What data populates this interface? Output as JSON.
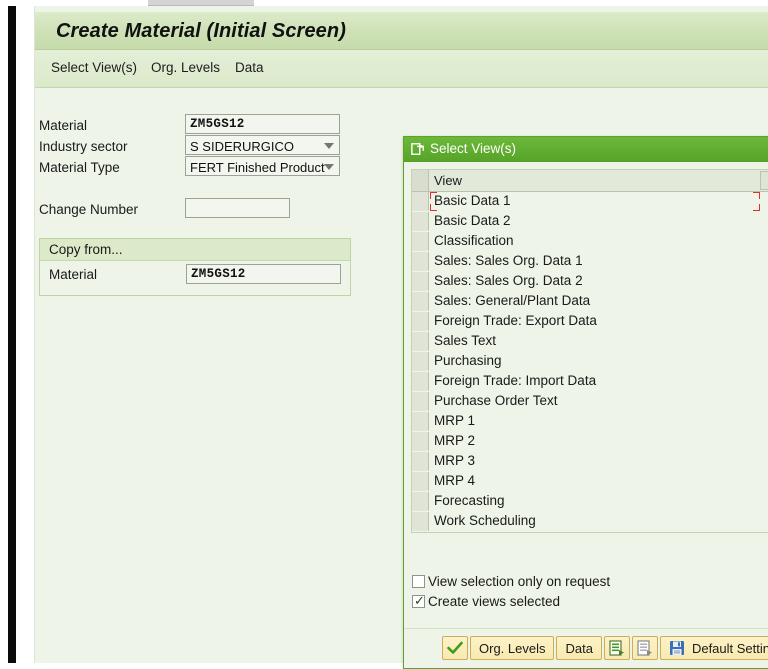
{
  "window": {
    "title": "Create Material (Initial Screen)",
    "menu": [
      {
        "label": "Select View(s)",
        "name": "menu-select-views"
      },
      {
        "label": "Org. Levels",
        "name": "menu-org-levels"
      },
      {
        "label": "Data",
        "name": "menu-data"
      }
    ]
  },
  "form": {
    "material": {
      "label": "Material",
      "value": "ZM5GS12"
    },
    "industry_sector": {
      "label": "Industry sector",
      "value": "S SIDERURGICO"
    },
    "material_type": {
      "label": "Material Type",
      "value": "FERT Finished Product"
    },
    "change_number": {
      "label": "Change Number",
      "value": ""
    },
    "copy_from": {
      "title": "Copy from...",
      "material": {
        "label": "Material",
        "value": "ZM5GS12"
      }
    }
  },
  "dialog": {
    "title": "Select View(s)",
    "title_icon": "select-views-icon",
    "close_icon": "close-icon",
    "table": {
      "column_header": "View",
      "rows": [
        {
          "label": "Basic Data 1",
          "checked": false
        },
        {
          "label": "Basic Data 2",
          "checked": false
        },
        {
          "label": "Classification",
          "checked": false
        },
        {
          "label": "Sales: Sales Org. Data 1",
          "checked": false
        },
        {
          "label": "Sales: Sales Org. Data 2",
          "checked": false
        },
        {
          "label": "Sales: General/Plant Data",
          "checked": false
        },
        {
          "label": "Foreign Trade: Export Data",
          "checked": false
        },
        {
          "label": "Sales Text",
          "checked": false
        },
        {
          "label": "Purchasing",
          "checked": false
        },
        {
          "label": "Foreign Trade: Import Data",
          "checked": false
        },
        {
          "label": "Purchase Order Text",
          "checked": false
        },
        {
          "label": "MRP 1",
          "checked": false
        },
        {
          "label": "MRP 2",
          "checked": false
        },
        {
          "label": "MRP 3",
          "checked": false
        },
        {
          "label": "MRP 4",
          "checked": false
        },
        {
          "label": "Forecasting",
          "checked": false
        },
        {
          "label": "Work Scheduling",
          "checked": false
        }
      ]
    },
    "options": [
      {
        "label": "View selection only on request",
        "checked": false,
        "name": "view-selection-only-on-request-checkbox"
      },
      {
        "label": "Create views selected",
        "checked": true,
        "name": "create-views-selected-checkbox"
      }
    ],
    "buttons": [
      {
        "label": "",
        "icon": "green-check-icon",
        "name": "continue-button"
      },
      {
        "label": "Org. Levels",
        "icon": "",
        "name": "org-levels-button"
      },
      {
        "label": "Data",
        "icon": "",
        "name": "data-button"
      },
      {
        "label": "",
        "icon": "select-all-views-icon",
        "name": "select-all-button"
      },
      {
        "label": "",
        "icon": "deselect-all-views-icon",
        "name": "deselect-all-button"
      },
      {
        "label": "Default Setting",
        "icon": "save-disk-icon",
        "name": "default-setting-button"
      },
      {
        "label": "",
        "icon": "red-cancel-icon",
        "name": "cancel-button"
      }
    ]
  },
  "colors": {
    "title_bar": "#cde1b5",
    "dialog_header": "#56a328",
    "content_bg": "#eef4e8",
    "button_yellow": "#f8e9ae",
    "focus_marker": "#e03030"
  }
}
